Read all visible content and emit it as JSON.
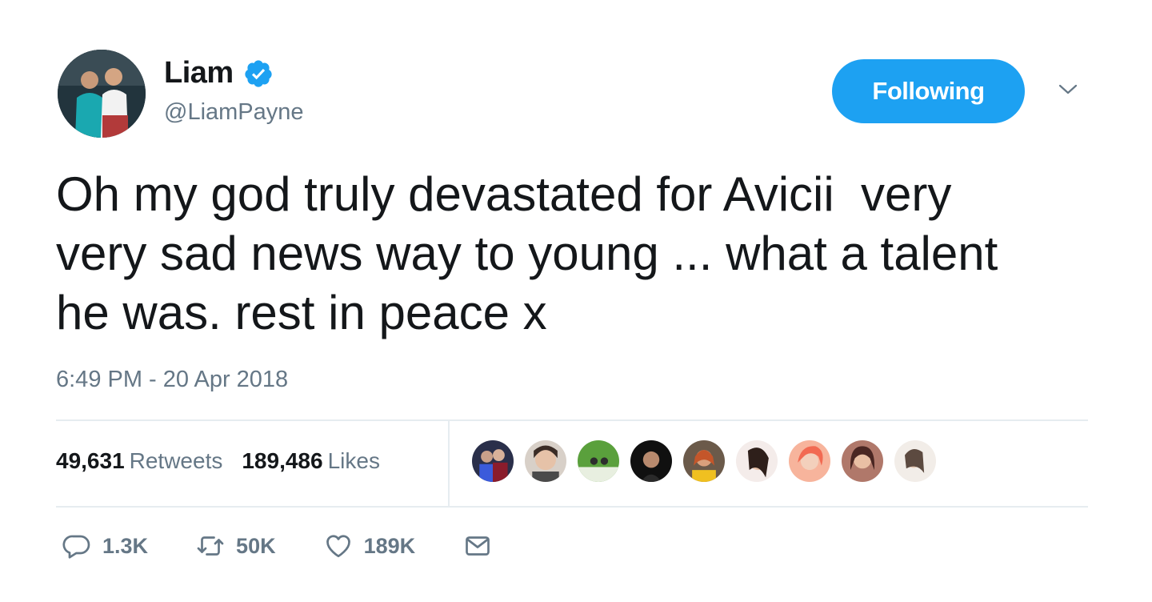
{
  "user": {
    "display_name": "Liam",
    "handle": "@LiamPayne",
    "verified": true
  },
  "follow_button": {
    "label": "Following"
  },
  "tweet": {
    "text": "Oh my god truly devastated for Avicii  very\nvery sad news way to young ... what a talent\nhe was. rest in peace x",
    "timestamp": "6:49 PM - 20 Apr 2018"
  },
  "stats": {
    "retweets_count": "49,631",
    "retweets_label": "Retweets",
    "likes_count": "189,486",
    "likes_label": "Likes"
  },
  "actions": {
    "reply_count": "1.3K",
    "retweet_count": "50K",
    "like_count": "189K"
  },
  "colors": {
    "accent": "#1da1f2",
    "text": "#14171a",
    "secondary": "#657786",
    "divider": "#e6ecf0"
  },
  "icons": [
    "verified-badge-icon",
    "chevron-down-icon",
    "reply-icon",
    "retweet-icon",
    "like-icon",
    "direct-message-icon"
  ]
}
